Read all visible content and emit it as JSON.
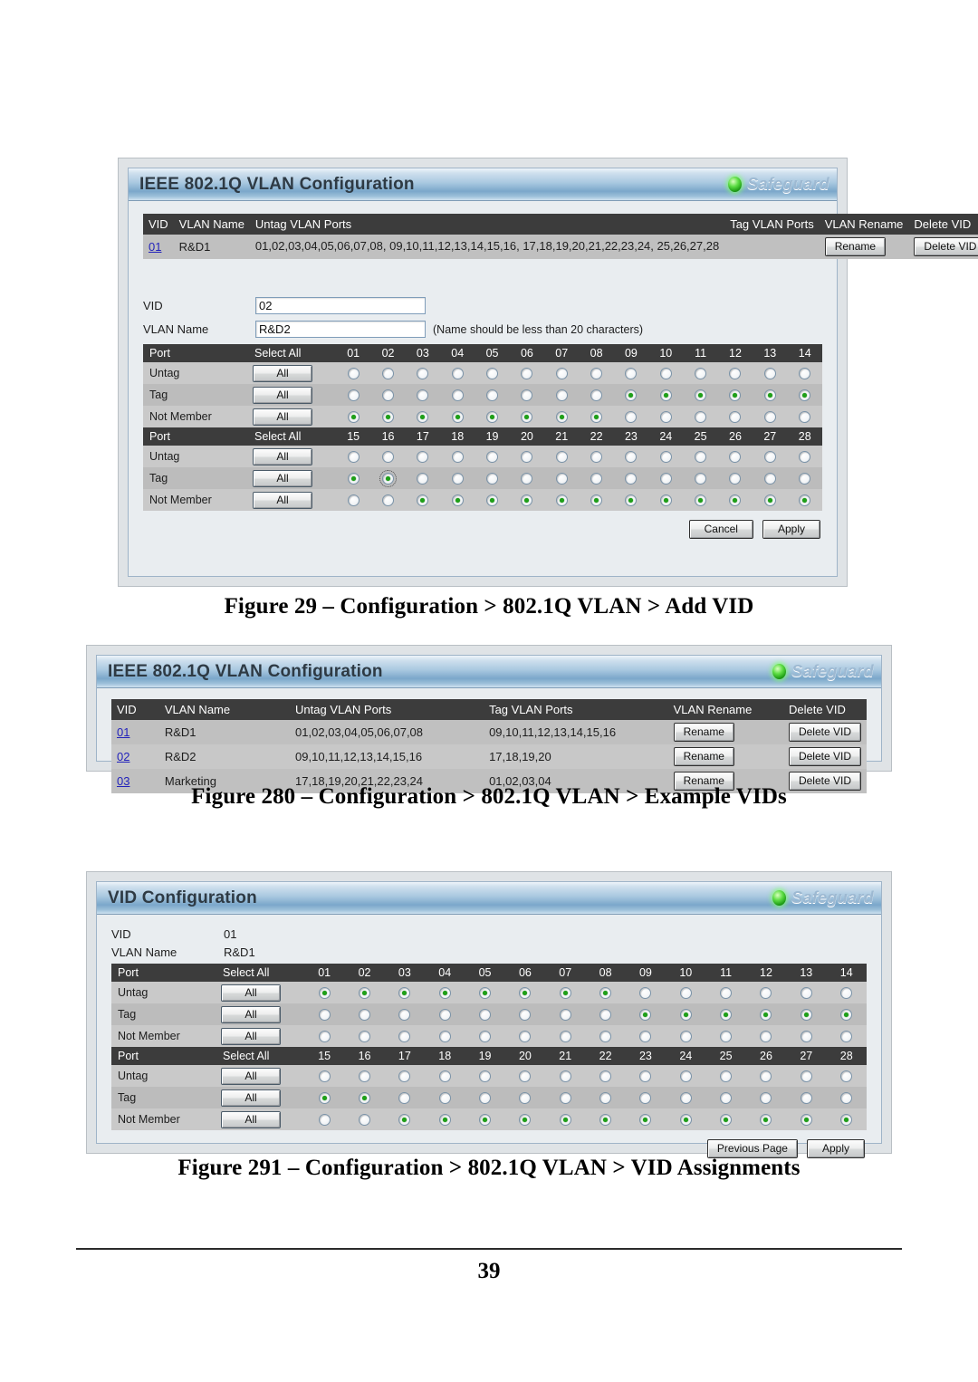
{
  "document": {
    "page_number": "39"
  },
  "figures": [
    {
      "id": "add-vid",
      "panel_title": "IEEE 802.1Q VLAN Configuration",
      "safeguard_label": "Safeguard",
      "caption": "Figure 29 – Configuration > 802.1Q VLAN > Add VID",
      "vlan_table": {
        "headers": [
          "VID",
          "VLAN Name",
          "Untag VLAN Ports",
          "Tag VLAN Ports",
          "VLAN Rename",
          "Delete VID"
        ],
        "rows": [
          {
            "vid": "01",
            "name": "R&D1",
            "untag_ports": "01,02,03,04,05,06,07,08, 09,10,11,12,13,14,15,16, 17,18,19,20,21,22,23,24, 25,26,27,28",
            "tag_ports": "",
            "rename_label": "Rename",
            "delete_label": "Delete VID"
          }
        ]
      },
      "form": {
        "vid_label": "VID",
        "vid_value": "02",
        "vlan_name_label": "VLAN Name",
        "vlan_name_value": "R&D2",
        "vlan_name_hint": "(Name should be less than 20 characters)"
      },
      "port_matrix": {
        "col_port_label": "Port",
        "col_selectall_label": "Select All",
        "all_button_label": "All",
        "row_labels": [
          "Untag",
          "Tag",
          "Not Member"
        ],
        "groups": [
          {
            "ports": [
              "01",
              "02",
              "03",
              "04",
              "05",
              "06",
              "07",
              "08",
              "09",
              "10",
              "11",
              "12",
              "13",
              "14"
            ],
            "untag": [
              false,
              false,
              false,
              false,
              false,
              false,
              false,
              false,
              false,
              false,
              false,
              false,
              false,
              false
            ],
            "tag": [
              false,
              false,
              false,
              false,
              false,
              false,
              false,
              false,
              true,
              true,
              true,
              true,
              true,
              true
            ],
            "not_member": [
              true,
              true,
              true,
              true,
              true,
              true,
              true,
              true,
              false,
              false,
              false,
              false,
              false,
              false
            ],
            "focus": {
              "row": -1,
              "index": -1
            }
          },
          {
            "ports": [
              "15",
              "16",
              "17",
              "18",
              "19",
              "20",
              "21",
              "22",
              "23",
              "24",
              "25",
              "26",
              "27",
              "28"
            ],
            "untag": [
              false,
              false,
              false,
              false,
              false,
              false,
              false,
              false,
              false,
              false,
              false,
              false,
              false,
              false
            ],
            "tag": [
              true,
              true,
              false,
              false,
              false,
              false,
              false,
              false,
              false,
              false,
              false,
              false,
              false,
              false
            ],
            "not_member": [
              false,
              false,
              true,
              true,
              true,
              true,
              true,
              true,
              true,
              true,
              true,
              true,
              true,
              true
            ],
            "focus": {
              "row": 1,
              "index": 1
            }
          }
        ]
      },
      "actions": [
        {
          "label": "Cancel",
          "name": "cancel-button"
        },
        {
          "label": "Apply",
          "name": "apply-button"
        }
      ]
    },
    {
      "id": "example-vids",
      "panel_title": "IEEE 802.1Q VLAN Configuration",
      "safeguard_label": "Safeguard",
      "caption": "Figure 280 – Configuration > 802.1Q VLAN > Example VIDs",
      "vlan_table": {
        "headers": [
          "VID",
          "VLAN Name",
          "Untag VLAN Ports",
          "Tag VLAN Ports",
          "VLAN Rename",
          "Delete VID"
        ],
        "rows": [
          {
            "vid": "01",
            "name": "R&D1",
            "untag_ports": "01,02,03,04,05,06,07,08",
            "tag_ports": "09,10,11,12,13,14,15,16",
            "rename_label": "Rename",
            "delete_label": "Delete VID"
          },
          {
            "vid": "02",
            "name": "R&D2",
            "untag_ports": "09,10,11,12,13,14,15,16",
            "tag_ports": "17,18,19,20",
            "rename_label": "Rename",
            "delete_label": "Delete VID"
          },
          {
            "vid": "03",
            "name": "Marketing",
            "untag_ports": "17,18,19,20,21,22,23,24",
            "tag_ports": "01,02,03,04",
            "rename_label": "Rename",
            "delete_label": "Delete VID"
          }
        ]
      }
    },
    {
      "id": "vid-assignments",
      "panel_title": "VID Configuration",
      "safeguard_label": "Safeguard",
      "caption": "Figure 291 – Configuration > 802.1Q VLAN > VID Assignments",
      "info": {
        "vid_label": "VID",
        "vid_value": "01",
        "vlan_name_label": "VLAN Name",
        "vlan_name_value": "R&D1"
      },
      "port_matrix": {
        "col_port_label": "Port",
        "col_selectall_label": "Select All",
        "all_button_label": "All",
        "row_labels": [
          "Untag",
          "Tag",
          "Not Member"
        ],
        "groups": [
          {
            "ports": [
              "01",
              "02",
              "03",
              "04",
              "05",
              "06",
              "07",
              "08",
              "09",
              "10",
              "11",
              "12",
              "13",
              "14"
            ],
            "untag": [
              true,
              true,
              true,
              true,
              true,
              true,
              true,
              true,
              false,
              false,
              false,
              false,
              false,
              false
            ],
            "tag": [
              false,
              false,
              false,
              false,
              false,
              false,
              false,
              false,
              true,
              true,
              true,
              true,
              true,
              true
            ],
            "not_member": [
              false,
              false,
              false,
              false,
              false,
              false,
              false,
              false,
              false,
              false,
              false,
              false,
              false,
              false
            ],
            "focus": {
              "row": -1,
              "index": -1
            }
          },
          {
            "ports": [
              "15",
              "16",
              "17",
              "18",
              "19",
              "20",
              "21",
              "22",
              "23",
              "24",
              "25",
              "26",
              "27",
              "28"
            ],
            "untag": [
              false,
              false,
              false,
              false,
              false,
              false,
              false,
              false,
              false,
              false,
              false,
              false,
              false,
              false
            ],
            "tag": [
              true,
              true,
              false,
              false,
              false,
              false,
              false,
              false,
              false,
              false,
              false,
              false,
              false,
              false
            ],
            "not_member": [
              false,
              false,
              true,
              true,
              true,
              true,
              true,
              true,
              true,
              true,
              true,
              true,
              true,
              true
            ],
            "focus": {
              "row": -1,
              "index": -1
            }
          }
        ]
      },
      "actions": [
        {
          "label": "Previous Page",
          "name": "previous-page-button"
        },
        {
          "label": "Apply",
          "name": "apply-button"
        }
      ]
    }
  ]
}
